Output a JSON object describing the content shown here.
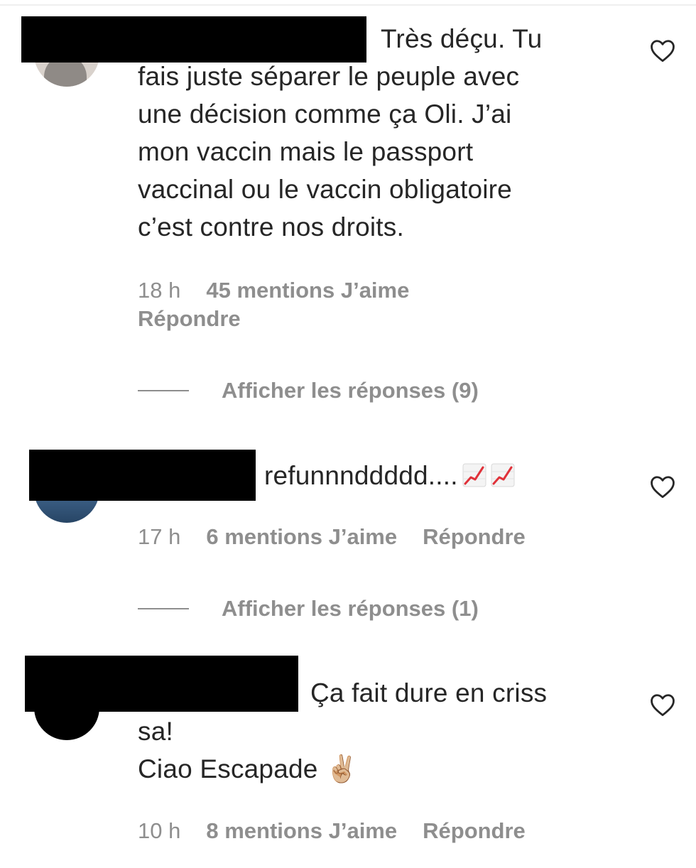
{
  "comments": [
    {
      "text_first": "Très déçu. Tu",
      "text_rest": "fais juste séparer le peuple avec\nune décision comme ça Oli. J’ai\nmon vaccin mais le passport\nvaccinal ou le vaccin obligatoire\nc’est contre nos droits.",
      "time": "18 h",
      "likes": "45 mentions J’aime",
      "reply": "Répondre",
      "view_replies": "Afficher les réponses (9)",
      "liked": false
    },
    {
      "text_first": "refunnnddddd....",
      "emoji": "chart-increasing-icon",
      "time": "17 h",
      "likes": "6 mentions J’aime",
      "reply": "Répondre",
      "view_replies": "Afficher les réponses (1)",
      "liked": false
    },
    {
      "text_first": "Ça fait dure en criss",
      "text_rest": "sa!\nCiao Escapade ✌🏼",
      "time": "10 h",
      "likes": "8 mentions J’aime",
      "reply": "Répondre",
      "liked": false
    }
  ],
  "colors": {
    "text": "#262626",
    "secondary": "#8e8e8e",
    "redaction": "#000000",
    "trend_red": "#e0323a"
  }
}
